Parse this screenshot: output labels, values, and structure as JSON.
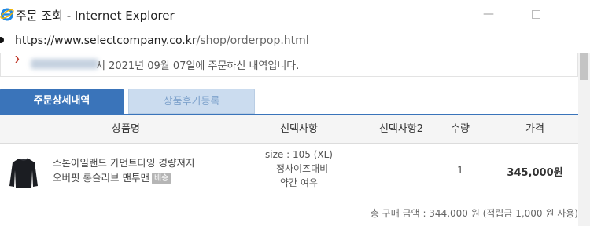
{
  "window": {
    "title": "주문 조회 - Internet Explorer",
    "min_glyph": "—",
    "icon": "internet-explorer-icon"
  },
  "address": {
    "url_host": "https://www.selectcompany.co.kr",
    "url_path": "/shop/orderpop.html"
  },
  "notice": {
    "mark": "❯",
    "message": "서 2021년 09월 07일에 주문하신 내역입니다."
  },
  "tabs": [
    {
      "label": "주문상세내역",
      "active": true
    },
    {
      "label": "상품후기등록",
      "active": false
    }
  ],
  "table": {
    "headers": [
      "상품명",
      "선택사항",
      "선택사항2",
      "수량",
      "가격"
    ],
    "rows": [
      {
        "product_line1": "스톤아일랜드 가먼트다잉 경량져지",
        "product_line2": "오버핏 롱슬리브 맨투맨",
        "badge": "배송",
        "option_line1": "size : 105 (XL)",
        "option_line2": "- 정사이즈대비",
        "option_line3": "약간 여유",
        "option2": "",
        "qty": "1",
        "price": "345,000원"
      }
    ]
  },
  "total": "총 구매 금액 : 344,000 원 (적립금 1,000 원 사용)",
  "colors": {
    "tab_active": "#3a74ba",
    "tab_inactive": "#cbdcef"
  }
}
